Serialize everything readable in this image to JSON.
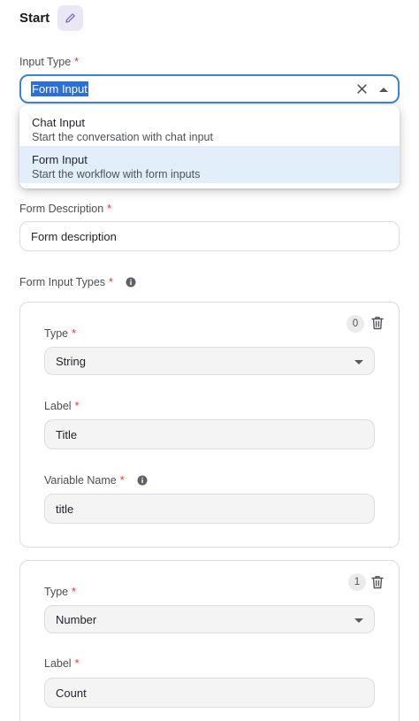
{
  "header": {
    "title": "Start",
    "edit_icon": "pencil-icon"
  },
  "input_type": {
    "label": "Input Type",
    "required_mark": "*",
    "selected_value": "Form Input",
    "clear_icon": "close-icon",
    "toggle_icon": "chevron-up-icon",
    "options": [
      {
        "label": "Chat Input",
        "description": "Start the conversation with chat input",
        "selected": false
      },
      {
        "label": "Form Input",
        "description": "Start the workflow with form inputs",
        "selected": true
      }
    ]
  },
  "form_description": {
    "label": "Form Description",
    "required_mark": "*",
    "value": "Form description"
  },
  "form_input_types": {
    "label": "Form Input Types",
    "required_mark": "*",
    "info_icon": "info-icon",
    "items": [
      {
        "index": "0",
        "type_label": "Type",
        "type_value": "String",
        "label_label": "Label",
        "label_value": "Title",
        "varname_label": "Variable Name",
        "varname_value": "title"
      },
      {
        "index": "1",
        "type_label": "Type",
        "type_value": "Number",
        "label_label": "Label",
        "label_value": "Count"
      }
    ]
  },
  "colors": {
    "accent": "#3d82d9",
    "required": "#e0383e",
    "edit_bg": "#ece7f7",
    "edit_icon": "#7c5cc4",
    "selected_option_bg": "#e3eefb"
  }
}
